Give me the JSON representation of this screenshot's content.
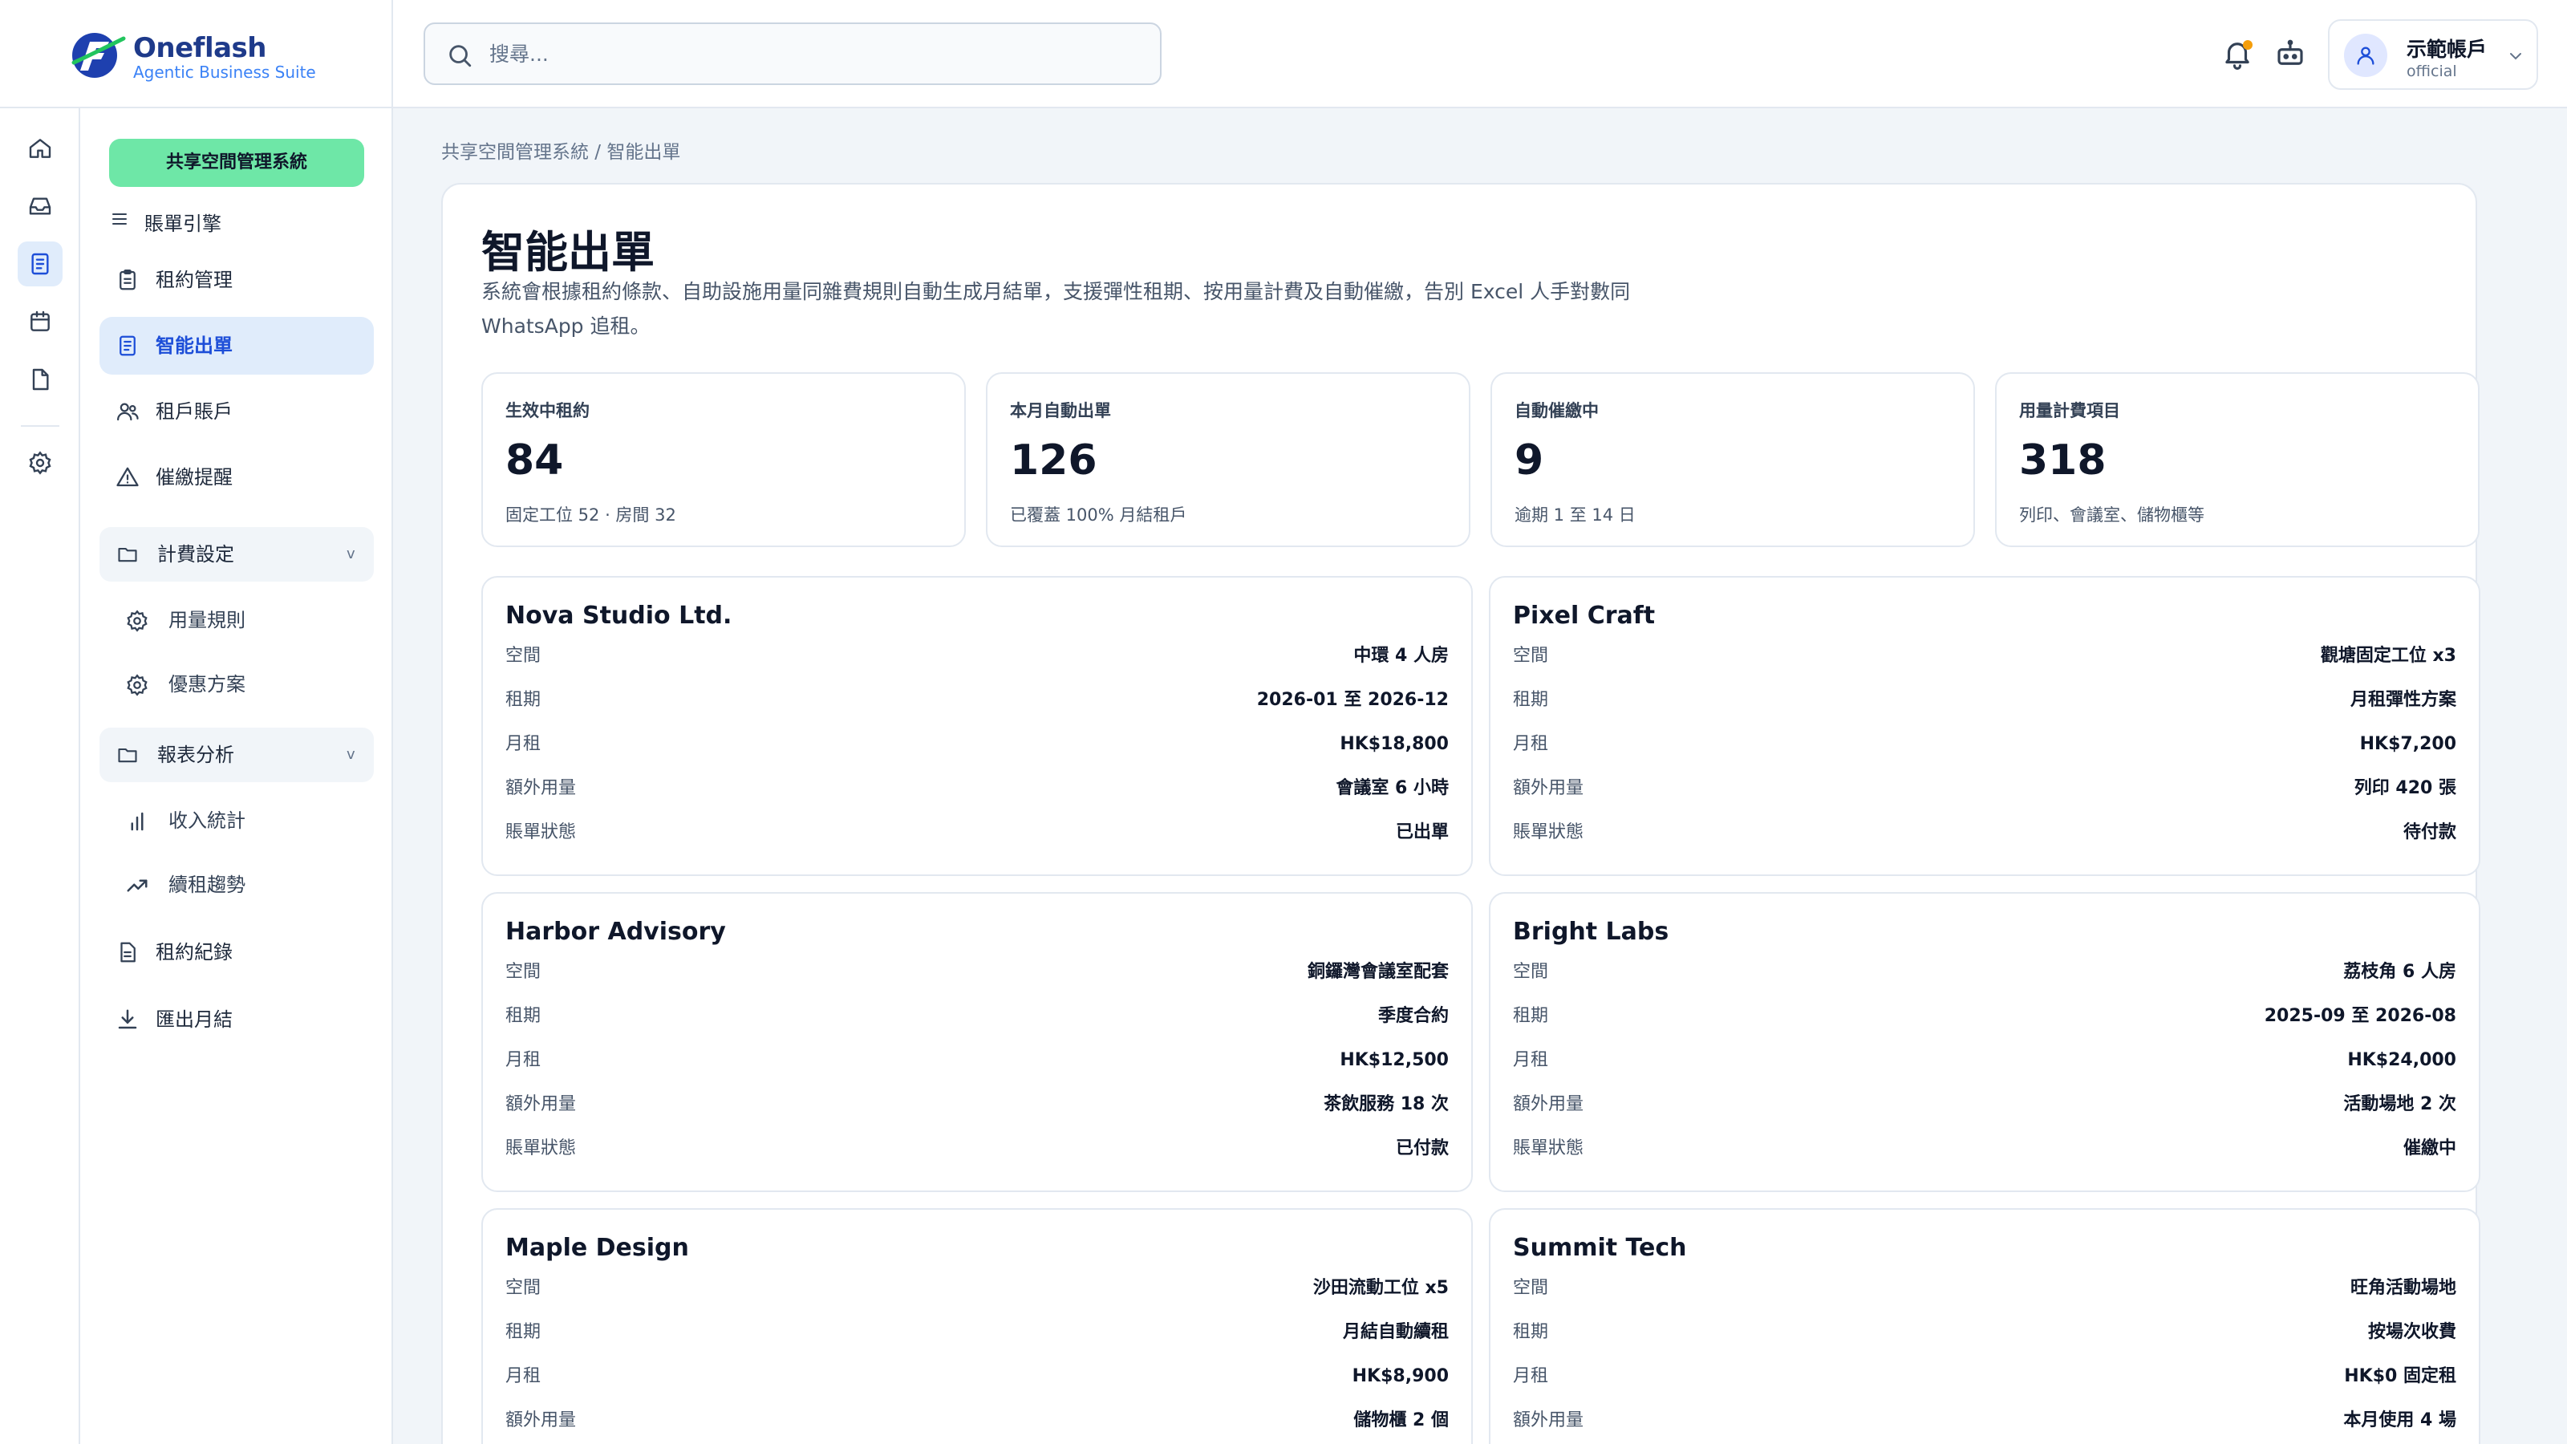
{
  "brand": {
    "name": "Oneflash",
    "tagline": "Agentic Business Suite"
  },
  "search": {
    "placeholder": "搜尋..."
  },
  "account": {
    "name": "示範帳戶",
    "role": "official"
  },
  "rail_icons": [
    "home-icon",
    "inbox-icon",
    "document-icon",
    "calendar-icon",
    "file-icon",
    "settings-icon"
  ],
  "sidebar": {
    "system_label": "共享空間管理系統",
    "engine_label": "賬單引擎",
    "items": [
      {
        "label": "租約管理",
        "icon": "clipboard-icon"
      },
      {
        "label": "智能出單",
        "icon": "invoice-icon",
        "active": true
      },
      {
        "label": "租戶賬戶",
        "icon": "users-icon"
      },
      {
        "label": "催繳提醒",
        "icon": "alert-triangle-icon"
      }
    ],
    "groups": [
      {
        "label": "計費設定",
        "chevron": "v",
        "children": [
          {
            "label": "用量規則",
            "icon": "gear-icon"
          },
          {
            "label": "優惠方案",
            "icon": "gear-icon"
          }
        ]
      },
      {
        "label": "報表分析",
        "chevron": "v",
        "children": [
          {
            "label": "收入統計",
            "icon": "bar-chart-icon"
          },
          {
            "label": "續租趨勢",
            "icon": "trend-up-icon"
          }
        ]
      }
    ],
    "bottom_items": [
      {
        "label": "租約紀錄",
        "icon": "document-list-icon"
      },
      {
        "label": "匯出月結",
        "icon": "download-icon"
      }
    ]
  },
  "breadcrumb": "共享空間管理系統 / 智能出單",
  "page": {
    "title": "智能出單",
    "description": "系統會根據租約條款、自助設施用量同雜費規則自動生成月結單，支援彈性租期、按用量計費及自動催繳，告別 Excel 人手對數同 WhatsApp 追租。"
  },
  "stats": [
    {
      "label": "生效中租約",
      "value": "84",
      "sub": "固定工位 52 · 房間 32"
    },
    {
      "label": "本月自動出單",
      "value": "126",
      "sub": "已覆蓋 100% 月結租戶"
    },
    {
      "label": "自動催繳中",
      "value": "9",
      "sub": "逾期 1 至 14 日"
    },
    {
      "label": "用量計費項目",
      "value": "318",
      "sub": "列印、會議室、儲物櫃等"
    }
  ],
  "field_labels": {
    "space": "空間",
    "term": "租期",
    "rent": "月租",
    "usage": "額外用量",
    "status": "賬單狀態"
  },
  "tenants": [
    {
      "name": "Nova Studio Ltd.",
      "space": "中環 4 人房",
      "term": "2026-01 至 2026-12",
      "rent": "HK$18,800",
      "usage": "會議室 6 小時",
      "status": "已出單"
    },
    {
      "name": "Pixel Craft",
      "space": "觀塘固定工位 x3",
      "term": "月租彈性方案",
      "rent": "HK$7,200",
      "usage": "列印 420 張",
      "status": "待付款"
    },
    {
      "name": "Harbor Advisory",
      "space": "銅鑼灣會議室配套",
      "term": "季度合約",
      "rent": "HK$12,500",
      "usage": "茶飲服務 18 次",
      "status": "已付款"
    },
    {
      "name": "Bright Labs",
      "space": "荔枝角 6 人房",
      "term": "2025-09 至 2026-08",
      "rent": "HK$24,000",
      "usage": "活動場地 2 次",
      "status": "催繳中"
    },
    {
      "name": "Maple Design",
      "space": "沙田流動工位 x5",
      "term": "月結自動續租",
      "rent": "HK$8,900",
      "usage": "儲物櫃 2 個",
      "status": ""
    },
    {
      "name": "Summit Tech",
      "space": "旺角活動場地",
      "term": "按場次收費",
      "rent": "HK$0 固定租",
      "usage": "本月使用 4 場",
      "status": ""
    }
  ]
}
